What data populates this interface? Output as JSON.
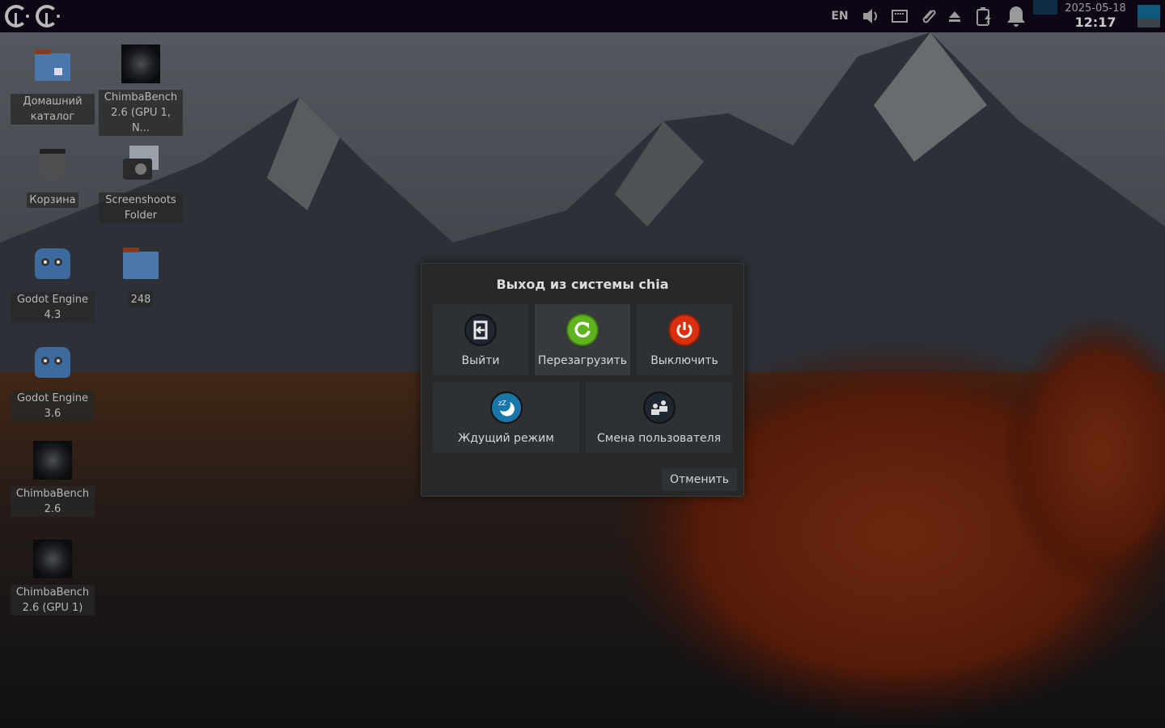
{
  "topbar": {
    "menu_logos": [
      "menu-logo",
      "menu-logo-2"
    ],
    "keyboard_layout": "EN",
    "tray_icons": [
      "volume-icon",
      "network-icon",
      "clipboard-paperclip-icon",
      "eject-icon",
      "battery-charging-icon",
      "notification-bell-icon"
    ],
    "clock": {
      "date": "2025-05-18",
      "time": "12:17"
    }
  },
  "desktop": {
    "icons": [
      {
        "label": "Домашний каталог",
        "icon": "home-folder-icon"
      },
      {
        "label": "ChimbaBench 2.6 (GPU 1, N...",
        "icon": "chimbabench-icon"
      },
      {
        "label": "Корзина",
        "icon": "trash-icon"
      },
      {
        "label": "Screenshoots Folder",
        "icon": "camera-icon"
      },
      {
        "label": "Godot Engine 4.3",
        "icon": "godot-icon"
      },
      {
        "label": "248",
        "icon": "folder-icon"
      },
      {
        "label": "Godot Engine 3.6",
        "icon": "godot-icon"
      },
      {
        "label": "ChimbaBench 2.6",
        "icon": "chimbabench-icon"
      },
      {
        "label": "ChimbaBench 2.6 (GPU 1)",
        "icon": "chimbabench-icon"
      }
    ]
  },
  "dialog": {
    "title": "Выход из системы chia",
    "actions": [
      {
        "label": "Выйти",
        "icon": "logout-icon",
        "color": "#1f2630"
      },
      {
        "label": "Перезагрузить",
        "icon": "reboot-icon",
        "color": "#5fb31f"
      },
      {
        "label": "Выключить",
        "icon": "power-icon",
        "color": "#d8300e"
      },
      {
        "label": "Ждущий режим",
        "icon": "suspend-icon",
        "color": "#1877a8"
      },
      {
        "label": "Смена пользователя",
        "icon": "switch-user-icon",
        "color": "#1f2630"
      }
    ],
    "cancel_label": "Отменить"
  }
}
